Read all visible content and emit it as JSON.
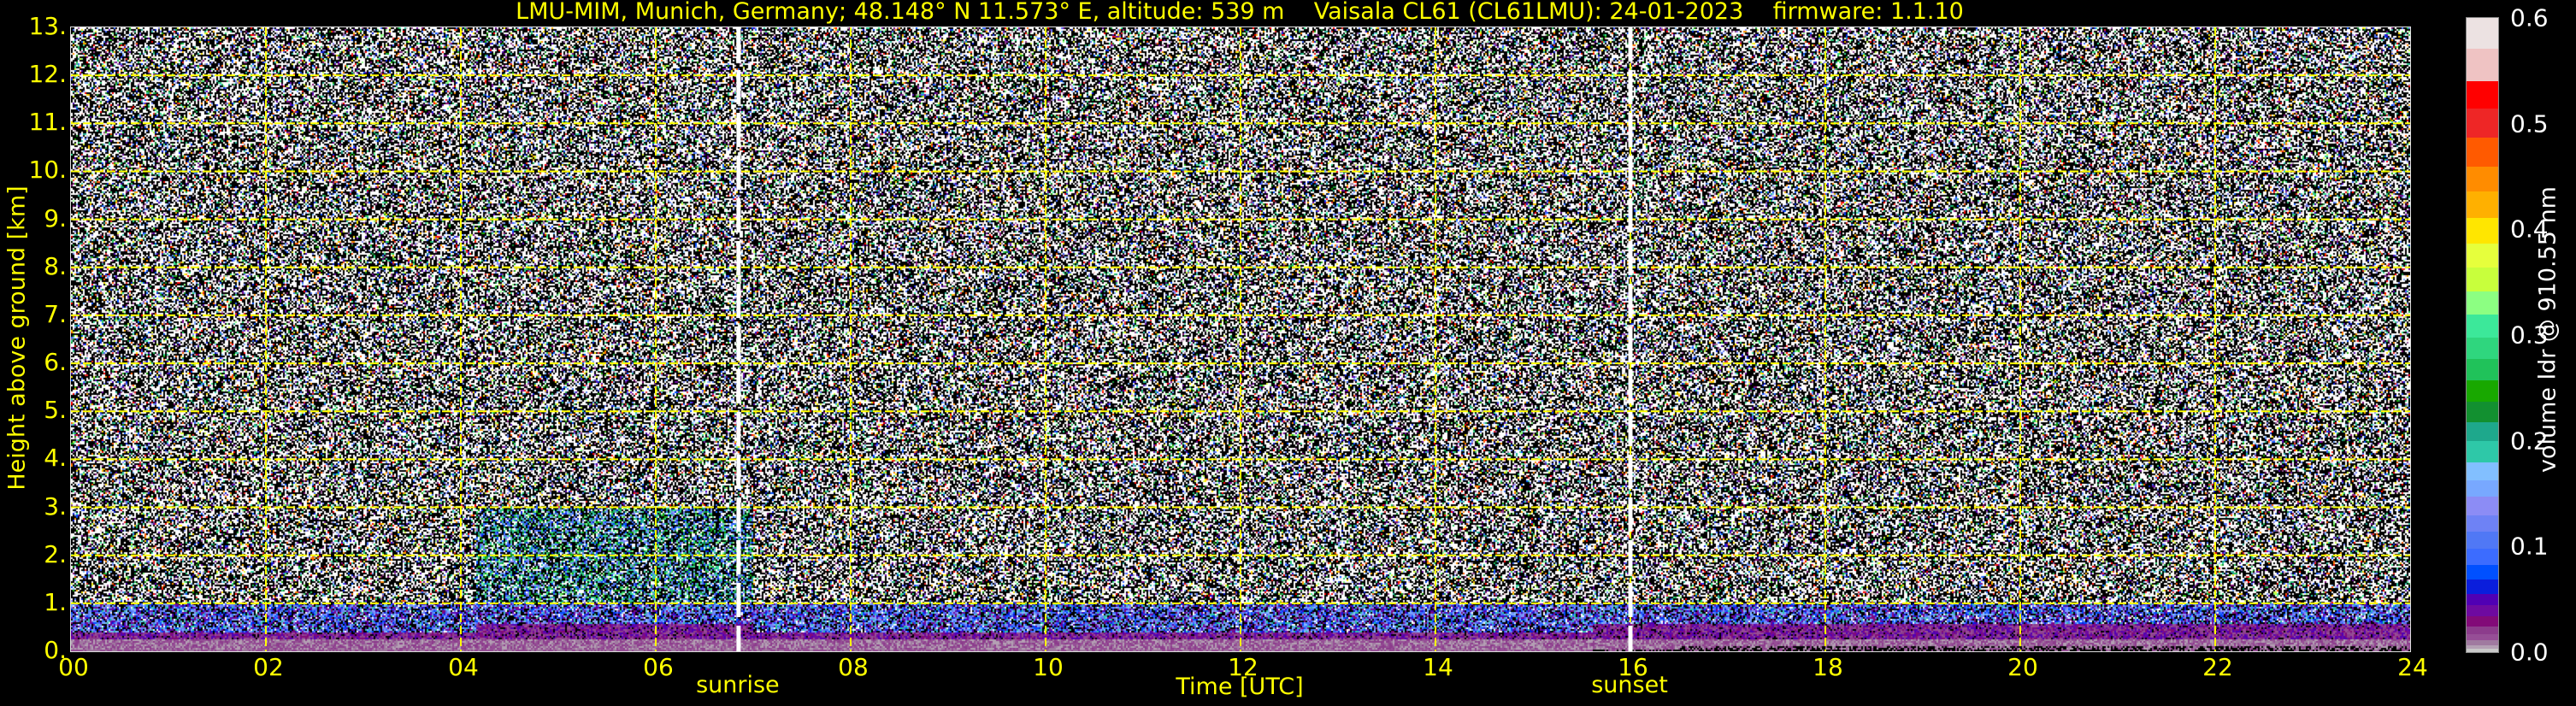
{
  "chart_data": {
    "type": "heatmap",
    "title": "LMU-MIM, Munich, Germany; 48.148° N 11.573° E, altitude: 539 m    Vaisala CL61 (CL61LMU): 24-01-2023    firmware: 1.1.10",
    "xlabel": "Time [UTC]",
    "ylabel": "Height above ground [km]",
    "xlim": [
      0,
      24
    ],
    "ylim": [
      0,
      13
    ],
    "x_ticks": [
      0,
      2,
      4,
      6,
      8,
      10,
      12,
      14,
      16,
      18,
      20,
      22,
      24
    ],
    "x_tick_labels": [
      "00",
      "02",
      "04",
      "06",
      "08",
      "10",
      "12",
      "14",
      "16",
      "18",
      "20",
      "22",
      "24"
    ],
    "y_ticks": [
      0,
      1,
      2,
      3,
      4,
      5,
      6,
      7,
      8,
      9,
      10,
      11,
      12,
      13
    ],
    "y_tick_labels": [
      "0.",
      "1.",
      "2.",
      "3.",
      "4.",
      "5.",
      "6.",
      "7.",
      "8.",
      "9.",
      "10.",
      "11.",
      "12.",
      "13."
    ],
    "grid": true,
    "grid_color": "#ffff00",
    "annotations": [
      {
        "label": "sunrise",
        "x": 6.85
      },
      {
        "label": "sunset",
        "x": 16.0
      }
    ],
    "colorbar": {
      "label": "volume ldr @ 910.55 nm",
      "range": [
        0,
        0.6
      ],
      "ticks": [
        0.0,
        0.1,
        0.2,
        0.3,
        0.4,
        0.5,
        0.6
      ],
      "tick_labels": [
        "0.0",
        "0.1",
        "0.2",
        "0.3",
        "0.4",
        "0.5",
        "0.6"
      ],
      "bounds": [
        0,
        0.003,
        0.007,
        0.012,
        0.017,
        0.025,
        0.034,
        0.045,
        0.056,
        0.069,
        0.083,
        0.098,
        0.114,
        0.13,
        0.147,
        0.163,
        0.18,
        0.2,
        0.218,
        0.237,
        0.257,
        0.277,
        0.298,
        0.32,
        0.342,
        0.364,
        0.387,
        0.411,
        0.436,
        0.46,
        0.487,
        0.515,
        0.541,
        0.571,
        0.6
      ],
      "colors": [
        "#c8c8c8",
        "#b4a0b4",
        "#a07aa0",
        "#964e96",
        "#8c3c8c",
        "#820a78",
        "#6e0aa0",
        "#5000b4",
        "#0a1edc",
        "#0050ff",
        "#3c6cff",
        "#5078f5",
        "#6e82f5",
        "#8c8cf5",
        "#78a8ff",
        "#82bfff",
        "#2ec8a8",
        "#1ea88c",
        "#129030",
        "#18a800",
        "#20c25a",
        "#2fd67e",
        "#3ce89a",
        "#8cff82",
        "#c8ff3c",
        "#e6ff3c",
        "#ffe600",
        "#ffb000",
        "#ff8c00",
        "#ff5a00",
        "#ee2626",
        "#ff0000",
        "#efc3c3",
        "#ece2e2",
        "#ffffff"
      ]
    },
    "features": {
      "boundary_layer_top_km": 1.0,
      "enhanced_signal_start_hour": 4.15,
      "enhanced_signal_end_hour": 7.0
    }
  }
}
